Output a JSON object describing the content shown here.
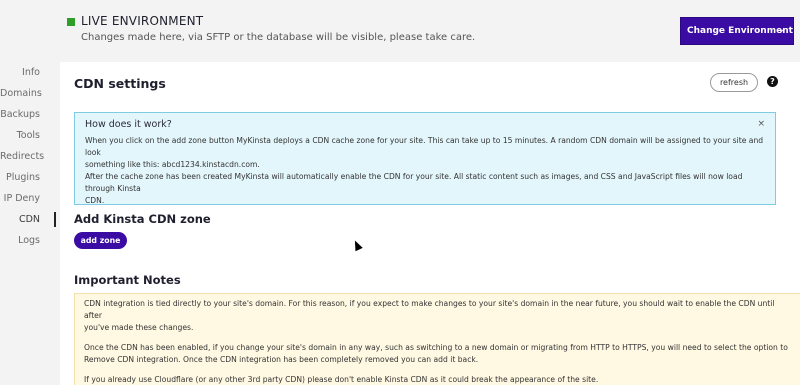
{
  "environment": {
    "title": "LIVE ENVIRONMENT",
    "subtitle": "Changes made here, via SFTP or the database will be visible, please take care.",
    "change_button": "Change Environment",
    "status_color": "#2f9d27",
    "accent_color": "#3a0ca3"
  },
  "sidebar": {
    "items": [
      {
        "label": "Info"
      },
      {
        "label": "Domains"
      },
      {
        "label": "Backups"
      },
      {
        "label": "Tools"
      },
      {
        "label": "Redirects"
      },
      {
        "label": "Plugins"
      },
      {
        "label": "IP Deny"
      },
      {
        "label": "CDN",
        "active": true
      },
      {
        "label": "Logs"
      }
    ]
  },
  "cdn": {
    "title": "CDN settings",
    "refresh_label": "refresh",
    "help_label": "?",
    "info": {
      "title": "How does it work?",
      "line1": "When you click on the add zone button MyKinsta deploys a CDN cache zone for your site. This can take up to 15 minutes. A random CDN domain will be assigned to your site and look",
      "line2": "something like this: abcd1234.kinstacdn.com.",
      "line3": "After the cache zone has been created MyKinsta will automatically enable the CDN for your site. All static content such as images, and CSS and JavaScript files will now load through Kinsta",
      "line4": "CDN.",
      "close_label": "×"
    },
    "add_zone": {
      "title": "Add Kinsta CDN zone",
      "button_label": "add zone"
    },
    "notes": {
      "title": "Important Notes",
      "p1a": "CDN integration is tied directly to your site's domain. For this reason, if you expect to make changes to your site's domain in the near future, you should wait to enable the CDN until after",
      "p1b": "you've made these changes.",
      "p2a": "Once the CDN has been enabled, if you change your site's domain in any way, such as switching to a new domain or migrating from HTTP to HTTPS, you will need to select the option to",
      "p2b": "Remove CDN integration. Once the CDN integration has been completely removed you can add it back.",
      "p3": "If you already use Cloudflare (or any other 3rd party CDN) please don't enable Kinsta CDN as it could break the appearance of the site."
    }
  }
}
